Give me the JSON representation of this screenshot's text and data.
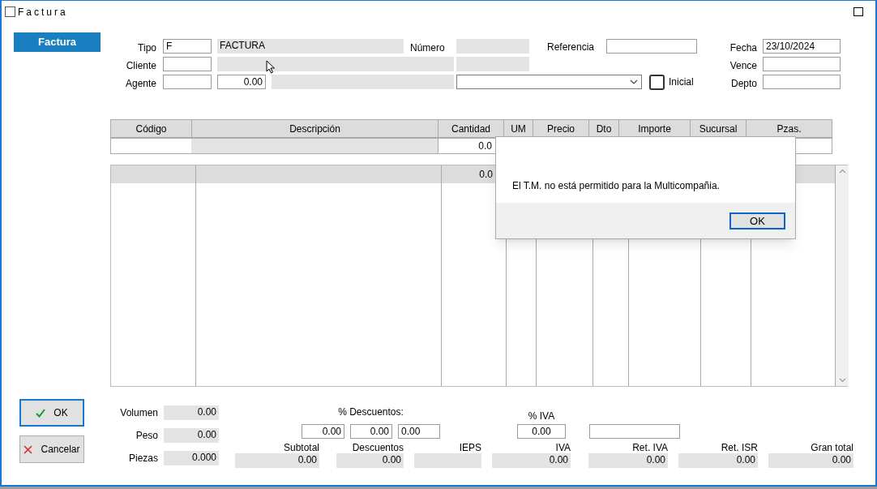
{
  "window": {
    "title": "Factura"
  },
  "side_tab": {
    "label": "Factura",
    "selected": true
  },
  "tipo": {
    "label": "Tipo",
    "value": "F",
    "name": "FACTURA"
  },
  "numero": {
    "label": "Número"
  },
  "referencia": {
    "label": "Referencia"
  },
  "fecha": {
    "label": "Fecha",
    "value": "23/10/2024"
  },
  "cliente": {
    "label": "Cliente"
  },
  "vence": {
    "label": "Vence"
  },
  "agente": {
    "label": "Agente",
    "amount": "0.00"
  },
  "inicial": {
    "label": "Inicial",
    "checked": false
  },
  "depto": {
    "label": "Depto"
  },
  "lines_table": {
    "columns": [
      "Código",
      "Descripción",
      "Cantidad",
      "UM",
      "Precio",
      "Dto",
      "Importe",
      "Sucursal",
      "Pzas."
    ],
    "entry_cantidad": "0.0"
  },
  "items_grid": {
    "summary_cantidad": "0.0"
  },
  "dialog": {
    "message": "El T.M. no está permitido para la Multicompañia.",
    "button": "OK"
  },
  "buttons": [
    {
      "label": "OK",
      "kind": "ok"
    },
    {
      "label": "Cancelar",
      "kind": "cancel"
    }
  ],
  "measures": [
    {
      "label": "Volumen",
      "value": "0.00"
    },
    {
      "label": "Peso",
      "value": "0.00"
    },
    {
      "label": "Piezas",
      "value": "0.000"
    }
  ],
  "discounts": {
    "label": "% Descuentos:",
    "values": [
      "0.00",
      "0.00",
      "0.00"
    ]
  },
  "iva_rate": {
    "label": "% IVA",
    "value": "0.00"
  },
  "totals": [
    {
      "label": "Subtotal",
      "value": "0.00"
    },
    {
      "label": "Descuentos",
      "value": "0.00"
    },
    {
      "label": "IEPS"
    },
    {
      "label": "IVA",
      "value": "0.00"
    },
    {
      "label": "Ret. IVA",
      "value": "0.00"
    },
    {
      "label": "Ret. ISR",
      "value": "0.00"
    },
    {
      "label": "Gran total",
      "value": "0.00"
    }
  ]
}
